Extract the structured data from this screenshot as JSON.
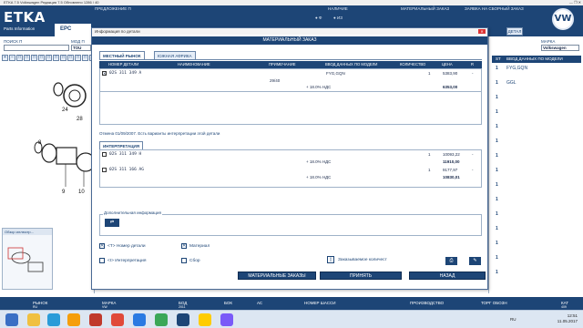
{
  "window": {
    "title": "ETKA 7.5 Volkswagen Редакция 7.5 Обновлено 1286 / 40",
    "controls": "— ❐ ✕"
  },
  "topbar": {
    "logo": "ETKA",
    "logo_sub": "Parts Information",
    "nav": [
      "ПРЕДЛОЖЕНИЕ П",
      "НАЛИЧИЕ",
      "МАТЕРИАЛЬНЫЙ ЗАКАЗ",
      "ЗАЯВКА НА СБОРНЫЙ ЗАКАЗ"
    ],
    "radio_options": [
      "Ф",
      "ИЗ"
    ],
    "brand_mark": "VW",
    "epc_tab": "EPC"
  },
  "left_panel": {
    "search_label": "ПОИСК П",
    "model_label": "МОД П",
    "model_value": "TOU",
    "zoom_buttons": [
      "+",
      "−",
      "□",
      "□",
      "□",
      "□",
      "□",
      "□",
      "□",
      "□",
      "□",
      "□",
      "□"
    ],
    "callouts": [
      "24",
      "28",
      "8",
      "9",
      "10"
    ],
    "overview_title": "Обзор иллюстр..."
  },
  "right_panel": {
    "brand_label": "МАРКА",
    "brand_value": "Volkswagen",
    "detail_btn": "ДЕТАЛ",
    "headers": [
      "ST",
      "ВВОД ДАННЫХ ПО МОДЕЛИ"
    ],
    "rows": [
      {
        "st": "1",
        "model": "FYG,GQN"
      },
      {
        "st": "1",
        "model": "GGL"
      },
      {
        "st": "1",
        "model": ""
      },
      {
        "st": "1",
        "model": ""
      },
      {
        "st": "1",
        "model": ""
      },
      {
        "st": "1",
        "model": ""
      },
      {
        "st": "1",
        "model": ""
      },
      {
        "st": "1",
        "model": ""
      },
      {
        "st": "1",
        "model": ""
      },
      {
        "st": "1",
        "model": ""
      },
      {
        "st": "1",
        "model": ""
      },
      {
        "st": "1",
        "model": ""
      },
      {
        "st": "1",
        "model": ""
      },
      {
        "st": "1",
        "model": ""
      },
      {
        "st": "1",
        "model": ""
      }
    ]
  },
  "modal": {
    "title": "Информация по детали",
    "close": "✕",
    "header": "МАТЕРИАЛЬНЫЙ ЗАКАЗ",
    "tabs": [
      "МЕСТНЫЙ РЫНОК",
      "ЮЖНАЯ АФРИКА"
    ],
    "table_headers": [
      "НОМЕР ДЕТАЛИ",
      "НАИМЕНОВАНИЕ",
      "ПРИМЕЧАНИЕ",
      "ВВОД ДАННЫХ ПО МОДЕЛИ",
      "КОЛИЧЕСТВО",
      "ЦЕНА",
      "R"
    ],
    "main_row": {
      "part_no": "02S 311 349 A",
      "remark": "29/40",
      "model_data": "FYG,GQN",
      "qty": "1",
      "price": "5383,90",
      "r": "-",
      "vat_label": "+ 18.0% НДС",
      "total": "6353,00"
    },
    "notice": "Отмена 01/09/2007. Есть варианты интерпретации этой детали",
    "interp_tab": "ИНТЕРПРЕТАЦИЯ",
    "interp_rows": [
      {
        "part_no": "02S 311 349 H",
        "qty": "1",
        "price": "10093,22",
        "r": "-",
        "vat_label": "+ 18.0% НДС",
        "total": "11910,00"
      },
      {
        "part_no": "02S 311 166 AG",
        "qty": "1",
        "price": "9177,97",
        "r": "-",
        "vat_label": "+ 18.0% НДС",
        "total": "10830,01"
      }
    ],
    "addinfo_label": "Дополнительная информация",
    "addinfo_icon": "⇄",
    "checks": {
      "part_no": "<Т> Номер детали",
      "material": "Материал",
      "interp": "<I> Интерпретация",
      "assembly": "Сбор",
      "ordered_qty": "Заказываемое количест"
    },
    "buttons": {
      "orders": "МАТЕРИАЛЬНЫЕ ЗАКАЗЫ",
      "accept": "ПРИНЯТЬ",
      "back": "НАЗАД"
    }
  },
  "statusbar": {
    "items": [
      "РЫНОК",
      "МАРКА",
      "БОД",
      "БОК",
      "АС",
      "НОМЕР ШАССИ",
      "ПРОИЗВОДСТВО",
      "ТОРГ ОБОЗН",
      "КАТ"
    ],
    "values": [
      "RU",
      "VW",
      "2011",
      "",
      "",
      "",
      "",
      "",
      "409"
    ]
  },
  "taskbar": {
    "time": "12:51",
    "date": "11.05.2017",
    "lang": "RU"
  }
}
